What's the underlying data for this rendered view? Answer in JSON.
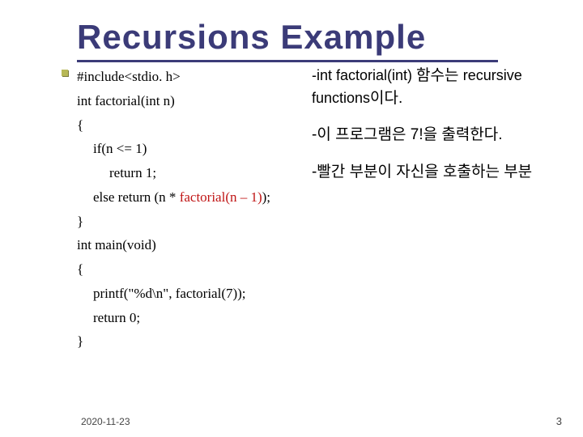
{
  "title": "Recursions Example",
  "code": {
    "l1": "#include<stdio. h>",
    "l2": "int factorial(int n)",
    "l3": "{",
    "l4": "if(n <= 1)",
    "l5": "return 1;",
    "l6a": "else return (n * ",
    "l6b": "factorial(n – 1)",
    "l6c": ");",
    "l7": "}",
    "l8": "int main(void)",
    "l9": "{",
    "l10": "printf(\"%d\\n\", factorial(7));",
    "l11": "return 0;",
    "l12": "}"
  },
  "notes": {
    "n1a": "-int factorial(int) ",
    "n1b": "함수는 ",
    "n1c": "recursive functions",
    "n1d": "이다.",
    "n2": "-이 프로그램은 7!을 출력한다.",
    "n3": "-빨간 부분이 자신을 호출하는 부분"
  },
  "footer": {
    "date": "2020-11-23",
    "page": "3"
  }
}
